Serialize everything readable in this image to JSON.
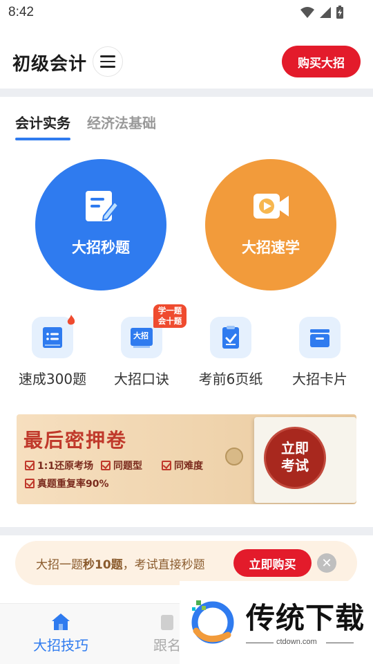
{
  "status_bar": {
    "time": "8:42"
  },
  "header": {
    "title": "初级会计",
    "buy_label": "购买大招"
  },
  "tabs": [
    {
      "label": "会计实务",
      "active": true
    },
    {
      "label": "经济法基础",
      "active": false
    }
  ],
  "feature_circles": [
    {
      "label": "大招秒题",
      "icon": "edit-document-icon",
      "color": "#2f7bef"
    },
    {
      "label": "大招速学",
      "icon": "video-camera-icon",
      "color": "#f29b3b"
    }
  ],
  "quick_items": [
    {
      "label": "速成300题",
      "icon": "book-list-icon"
    },
    {
      "label": "大招口诀",
      "icon": "formula-book-icon",
      "icon_text": "大招"
    },
    {
      "label": "考前6页纸",
      "icon": "clipboard-check-icon"
    },
    {
      "label": "大招卡片",
      "icon": "card-box-icon"
    }
  ],
  "badge": {
    "line1": "学一题",
    "line2": "会十题"
  },
  "banner": {
    "title": "最后密押卷",
    "features": [
      "1:1还原考场",
      "同题型",
      "同难度",
      "真题重复率90%"
    ],
    "seal_line1": "立即",
    "seal_line2": "考试"
  },
  "promo": {
    "text_before": "大招一题",
    "text_bold": "秒10题",
    "text_after": "，考试直接秒题",
    "buy_label": "立即购买",
    "close_glyph": "✕"
  },
  "bottom_nav": [
    {
      "label": "大招技巧",
      "icon": "home-icon",
      "active": true
    },
    {
      "label": "跟名",
      "icon": "nav-icon",
      "active": false
    }
  ],
  "watermark": {
    "text": "传统下载",
    "sub": "ctdown.com"
  },
  "colors": {
    "accent": "#2f7bef",
    "danger": "#e31b2b",
    "orange": "#f29b3b"
  }
}
